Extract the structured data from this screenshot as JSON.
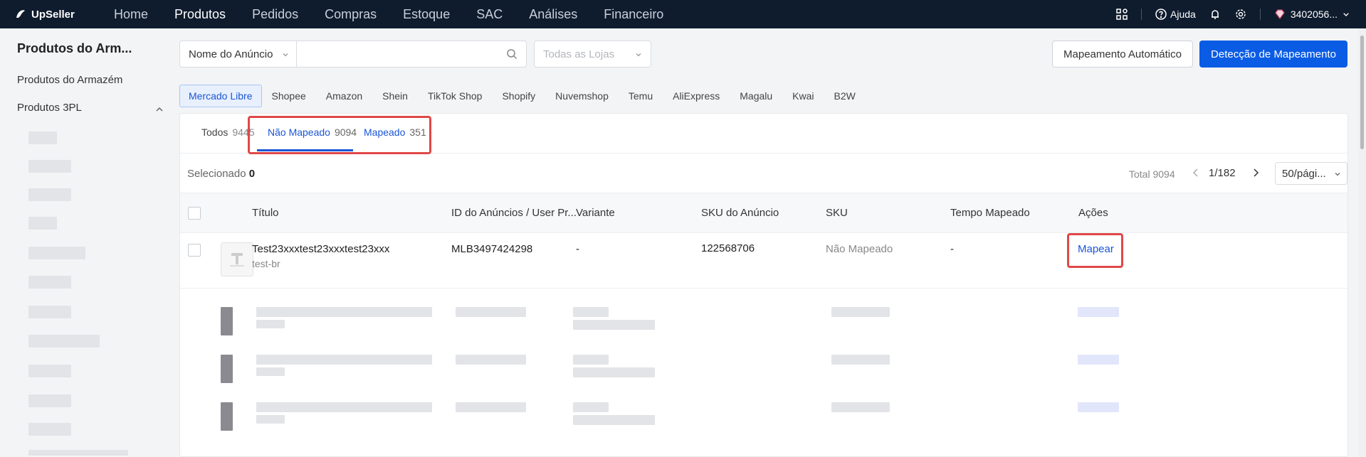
{
  "app": {
    "logo_text": "UpSeller"
  },
  "topnav": {
    "items": [
      {
        "label": "Home",
        "active": false
      },
      {
        "label": "Produtos",
        "active": true
      },
      {
        "label": "Pedidos",
        "active": false
      },
      {
        "label": "Compras",
        "active": false
      },
      {
        "label": "Estoque",
        "active": false
      },
      {
        "label": "SAC",
        "active": false
      },
      {
        "label": "Análises",
        "active": false
      },
      {
        "label": "Financeiro",
        "active": false
      }
    ],
    "help_label": "Ajuda",
    "account_label": "3402056..."
  },
  "sidebar": {
    "title": "Produtos do Arm...",
    "items": [
      {
        "label": "Produtos do Armazém"
      },
      {
        "label": "Produtos 3PL"
      }
    ]
  },
  "filters": {
    "field_select": "Nome do Anúncio",
    "search_placeholder": "",
    "store_select_placeholder": "Todas as Lojas",
    "auto_mapping_button": "Mapeamento Automático",
    "detect_mapping_button": "Detecção de Mapeamento"
  },
  "channels": [
    {
      "label": "Mercado Libre",
      "active": true
    },
    {
      "label": "Shopee"
    },
    {
      "label": "Amazon"
    },
    {
      "label": "Shein"
    },
    {
      "label": "TikTok Shop"
    },
    {
      "label": "Shopify"
    },
    {
      "label": "Nuvemshop"
    },
    {
      "label": "Temu"
    },
    {
      "label": "AliExpress"
    },
    {
      "label": "Magalu"
    },
    {
      "label": "Kwai"
    },
    {
      "label": "B2W"
    }
  ],
  "tabs": [
    {
      "label": "Todos",
      "count": "9445"
    },
    {
      "label": "Não Mapeado",
      "count": "9094",
      "active": true
    },
    {
      "label": "Mapeado",
      "count": "351"
    }
  ],
  "toolbar": {
    "selected_label": "Selecionado",
    "selected_count": "0",
    "total_text": "Total 9094",
    "page_text": "1/182",
    "per_page": "50/pági..."
  },
  "table": {
    "columns": [
      "Título",
      "ID do Anúncios / User Pr...",
      "Variante",
      "SKU do Anúncio",
      "SKU",
      "Tempo Mapeado",
      "Ações"
    ],
    "rows": [
      {
        "title": "Test23xxxtest23xxxtest23xxx",
        "store": "test-br",
        "listing_id": "MLB3497424298",
        "variant": "-",
        "listing_sku": "122568706",
        "sku": "Não Mapeado",
        "mapped_time": "-",
        "action": "Mapear"
      }
    ]
  },
  "colors": {
    "nav_bg": "#0f1c2e",
    "primary": "#0b5ce5",
    "link": "#1a55d6",
    "highlight": "#e04848"
  }
}
